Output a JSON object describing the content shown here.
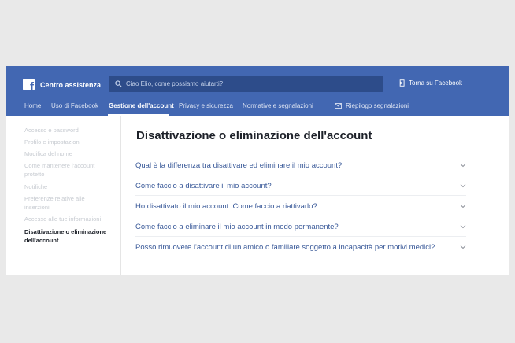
{
  "header": {
    "brand_title": "Centro assistenza",
    "search_placeholder": "Ciao Elio, come possiamo aiutarti?",
    "back_label": "Torna su Facebook"
  },
  "nav": {
    "items": [
      "Home",
      "Uso di Facebook",
      "Gestione dell'account",
      "Privacy e sicurezza",
      "Normative e segnalazioni"
    ],
    "active_index": 2,
    "summary_label": "Riepilogo segnalazioni"
  },
  "sidebar": {
    "links": [
      "Accesso e password",
      "Profilo e impostazioni",
      "Modifica del nome",
      "Come mantenere l'account protetto",
      "Notifiche",
      "Preferenze relative alle inserzioni",
      "Accesso alle tue informazioni",
      "Disattivazione o eliminazione dell'account"
    ],
    "active_index": 7
  },
  "main": {
    "title": "Disattivazione o eliminazione dell'account",
    "questions": [
      "Qual è la differenza tra disattivare ed eliminare il mio account?",
      "Come faccio a disattivare il mio account?",
      "Ho disattivato il mio account. Come faccio a riattivarlo?",
      "Come faccio a eliminare il mio account in modo permanente?",
      "Posso rimuovere l'account di un amico o familiare soggetto a incapacità per motivi medici?"
    ]
  },
  "colors": {
    "brand_blue": "#4267b2",
    "search_bg": "#2d4c8a",
    "link_blue": "#385898",
    "page_bg": "#e9e9e9"
  },
  "icons": {
    "logo": "facebook-logo-icon",
    "search": "search-icon",
    "back": "exit-icon",
    "summary": "inbox-icon",
    "chevron": "chevron-down-icon"
  }
}
